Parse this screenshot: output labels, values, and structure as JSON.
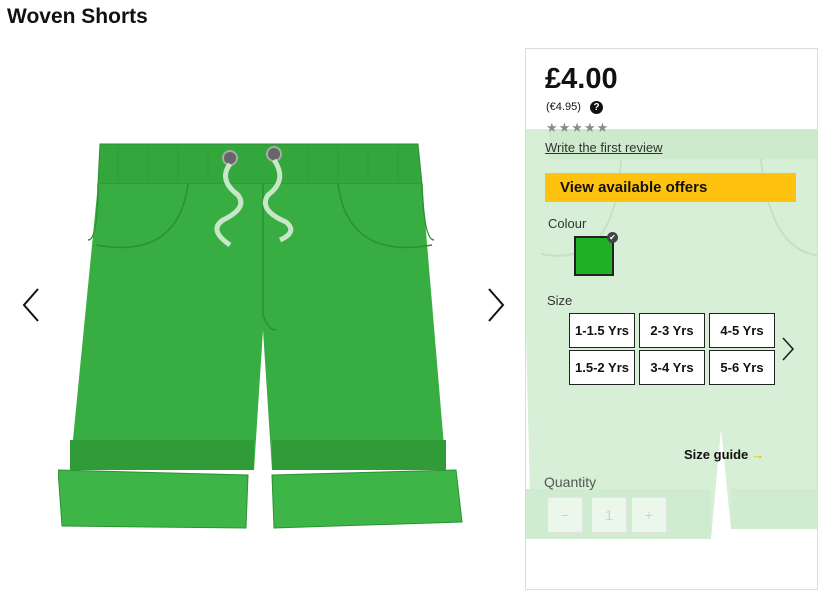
{
  "product": {
    "title": "Woven Shorts",
    "price": "£4.00",
    "price_alt": "(€4.95)",
    "help_glyph": "?",
    "stars": "★★★★★",
    "rating_stars": 0,
    "review_link": "Write the first review",
    "offers_button": "View available offers",
    "colour_label": "Colour",
    "selected_colour": "#1fb024",
    "size_label": "Size",
    "sizes": [
      "1-1.5 Yrs",
      "2-3 Yrs",
      "4-5 Yrs",
      "1.5-2 Yrs",
      "3-4 Yrs",
      "5-6 Yrs"
    ],
    "size_guide": "Size guide",
    "size_guide_arrow": "→",
    "quantity_label": "Quantity",
    "quantity_minus": "−",
    "quantity_value": "1",
    "quantity_plus": "+"
  },
  "icons": {
    "gallery_prev": "chevron-left-icon",
    "gallery_next": "chevron-right-icon",
    "size_next": "chevron-right-icon",
    "help": "question-circle-icon",
    "selected": "check-icon"
  },
  "colors": {
    "offers_button": "#ffc20e",
    "shorts_green": "#34a83e",
    "star_empty": "#8a8a8a"
  }
}
